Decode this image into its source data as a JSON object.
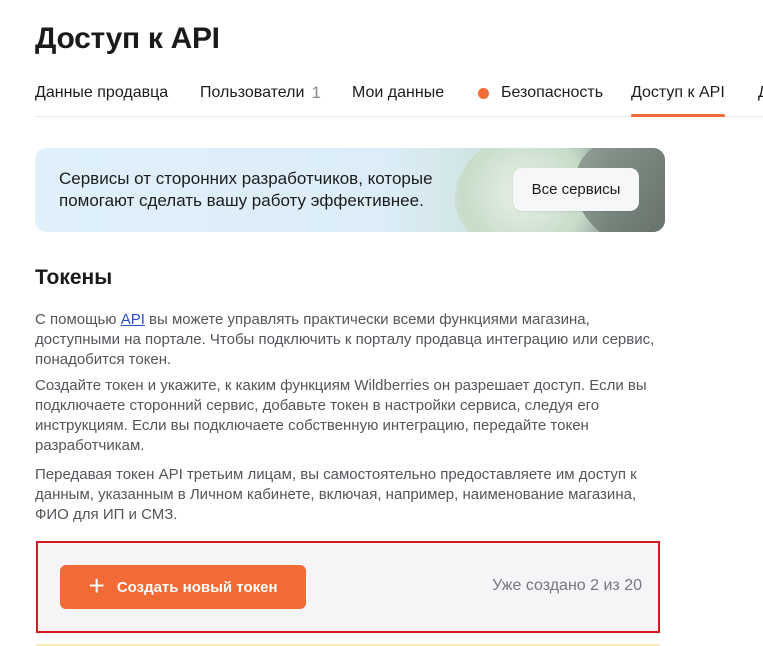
{
  "page": {
    "title": "Доступ к API"
  },
  "tabs": [
    {
      "label": "Данные продавца"
    },
    {
      "label": "Пользователи",
      "badge": "1"
    },
    {
      "label": "Мои данные"
    },
    {
      "label": "Безопасность",
      "dot_color": "#f26a35"
    },
    {
      "label": "Доступ к API",
      "active": true
    },
    {
      "label": "Д"
    }
  ],
  "banner": {
    "text": "Сервисы от сторонних разработчиков, которые помогают сделать вашу работу эффективнее.",
    "button_label": "Все сервисы"
  },
  "tokens": {
    "title": "Токены",
    "p1_before": "С помощью ",
    "p1_link": "API",
    "p1_after": " вы можете управлять практически всеми функциями магазина, доступными на портале. Чтобы подключить к порталу продавца интеграцию или сервис, понадобится токен.",
    "p2": "Создайте токен и укажите, к каким функциям Wildberries он разрешает доступ. Если вы подключаете сторонний сервис, добавьте токен в настройки сервиса, следуя его инструкциям. Если вы подключаете собственную интеграцию, передайте токен разработчикам.",
    "p3": "Передавая токен API третьим лицам, вы самостоятельно предоставляете им доступ к данным, указанным в Личном кабинете, включая, например, наименование магазина, ФИО для ИП и СМЗ.",
    "create_button_icon": "plus-icon",
    "create_button_label": "Создать новый токен",
    "created_status": "Уже создано 2 из 20"
  },
  "colors": {
    "accent": "#f26a35",
    "link": "#2950c7",
    "highlight_border": "#d71920"
  }
}
